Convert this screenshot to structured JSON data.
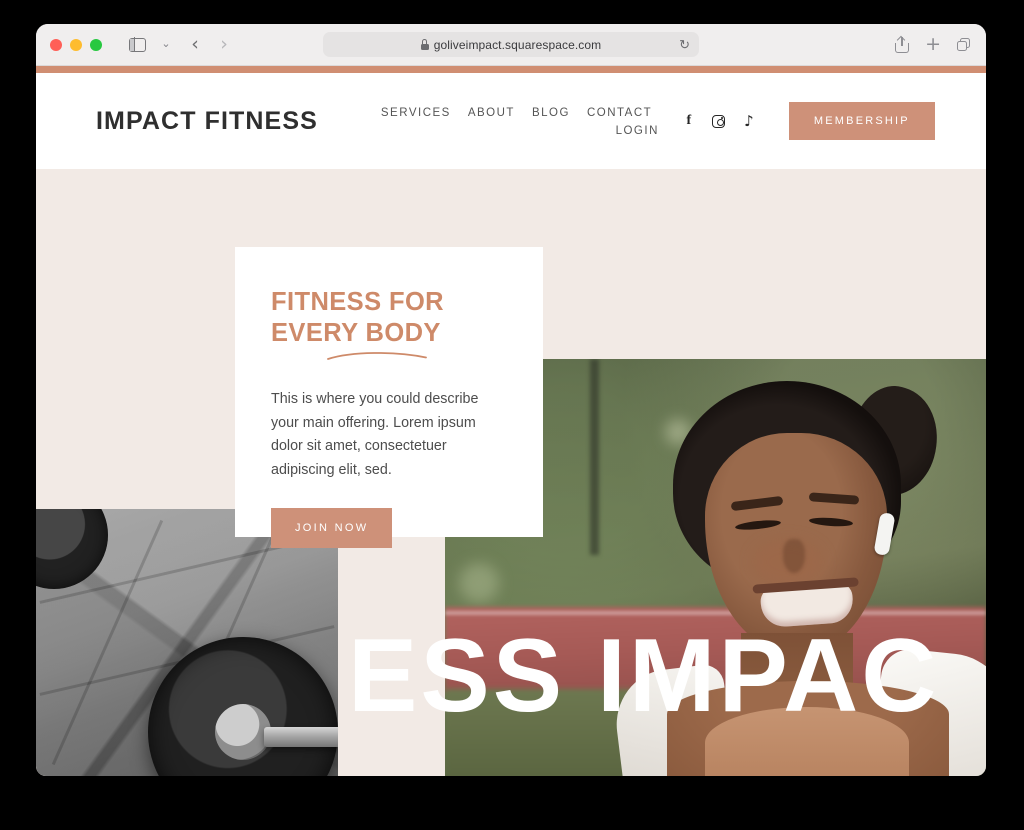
{
  "browser": {
    "url": "goliveimpact.squarespace.com",
    "lock_icon": "lock-icon",
    "reload_icon": "↻",
    "back_icon": "‹",
    "forward_icon": "›",
    "sidebar_icon": "sidebar-toggle-icon",
    "dropdown_icon": "⌄",
    "share_icon": "share-icon",
    "new_tab_icon": "+",
    "tabs_icon": "tab-overview-icon",
    "traffic_lights": [
      "close",
      "minimize",
      "maximize"
    ]
  },
  "site": {
    "accent_color": "#D08E72",
    "button_color": "#CE9179",
    "page_background": "#F2EAE5",
    "heading_color": "#CE8A69",
    "logo": "IMPACT FITNESS",
    "nav_row1": [
      "SERVICES",
      "ABOUT",
      "BLOG",
      "CONTACT"
    ],
    "nav_row2": [
      "LOGIN"
    ],
    "socials": [
      {
        "name": "facebook-icon",
        "glyph": "f"
      },
      {
        "name": "instagram-icon",
        "glyph": ""
      },
      {
        "name": "tiktok-icon",
        "glyph": "♪"
      }
    ],
    "membership_label": "MEMBERSHIP"
  },
  "hero": {
    "heading_line1": "FITNESS FOR",
    "heading_line2": "EVERY BODY",
    "paragraph": "This is where you could describe your main offering. Lorem ipsum dolor sit amet, consectetuer adipiscing elit, sed.",
    "cta_label": "JOIN NOW",
    "marquee_text": "ESS IMPAC",
    "image_left_alt": "black-and-white barbell plates on tiled gym floor",
    "image_right_alt": "smiling woman in tan sports bra and white jacket wearing earbuds outdoors"
  }
}
